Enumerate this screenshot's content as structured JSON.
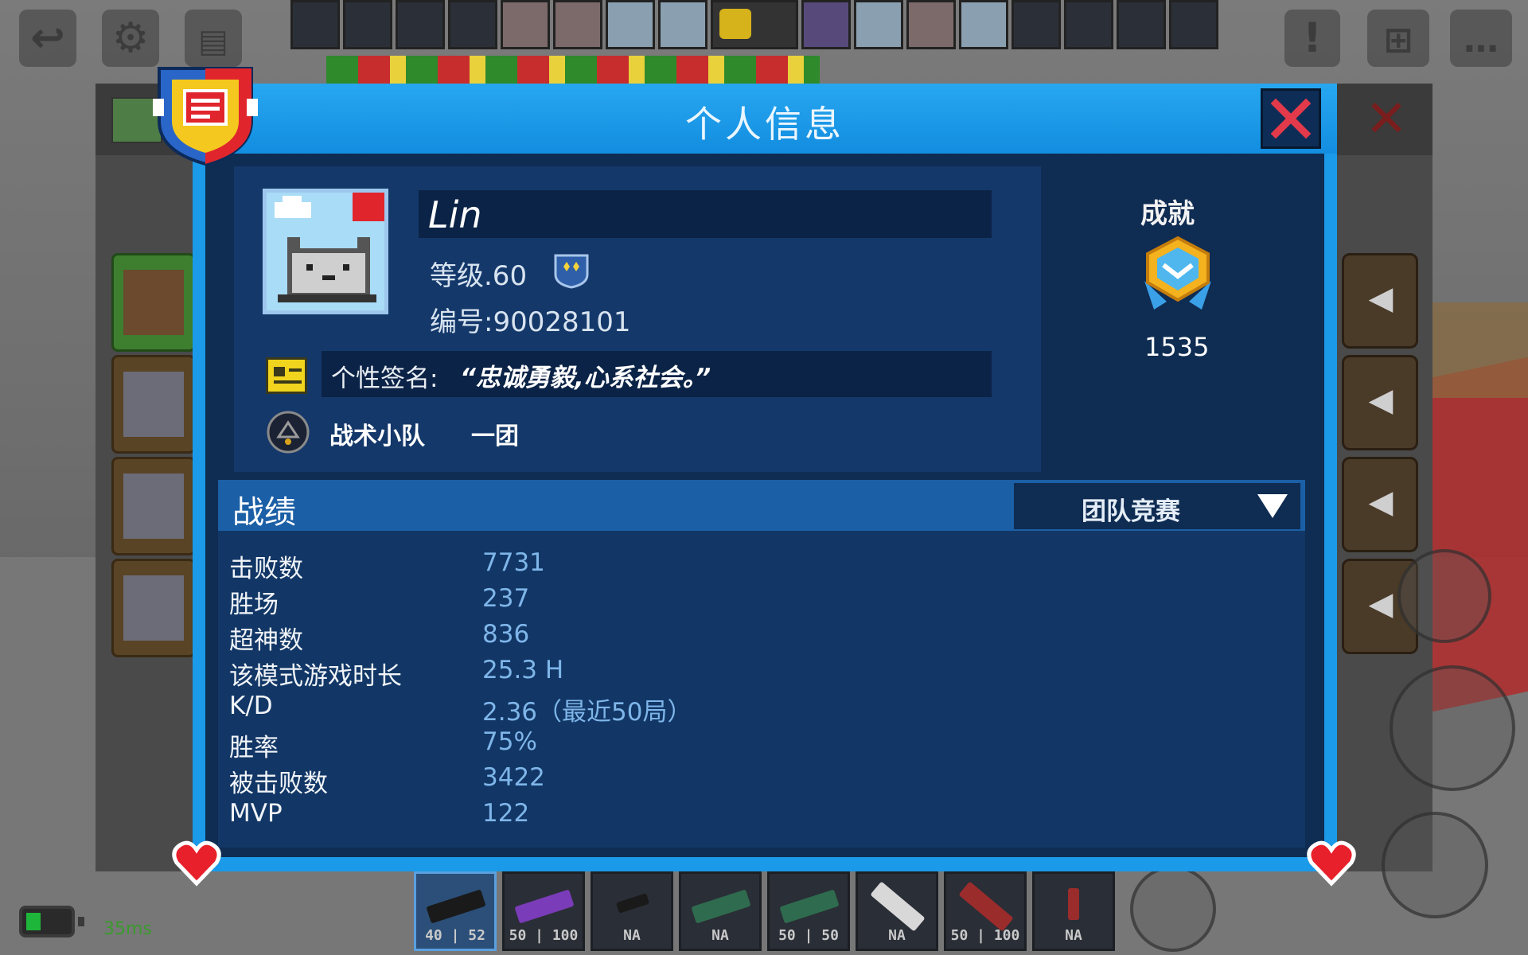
{
  "dialog": {
    "title": "个人信息"
  },
  "profile": {
    "name": "Lin",
    "level": "等级.60",
    "uid": "编号:90028101",
    "signature_label": "个性签名:",
    "signature": "“忠诚勇毅,心系社会。”",
    "squad_label": "战术小队",
    "squad_name": "一团"
  },
  "achievement": {
    "label": "成就",
    "value": "1535"
  },
  "stats": {
    "title": "战绩",
    "mode": "团队竞赛",
    "rows": [
      {
        "label": "击败数",
        "value": "7731"
      },
      {
        "label": "胜场",
        "value": "237"
      },
      {
        "label": "超神数",
        "value": "836"
      },
      {
        "label": "该模式游戏时长",
        "value": "25.3 H"
      },
      {
        "label": "K/D",
        "value": "2.36（最近50局）"
      },
      {
        "label": "胜率",
        "value": "75%"
      },
      {
        "label": "被击败数",
        "value": "3422"
      },
      {
        "label": "MVP",
        "value": "122"
      }
    ]
  },
  "hud": {
    "ping": "35ms",
    "weapons": [
      {
        "count": "40 | 52"
      },
      {
        "count": "50 | 100"
      },
      {
        "count": "NA"
      },
      {
        "count": "NA"
      },
      {
        "count": "50 | 50"
      },
      {
        "count": "NA"
      },
      {
        "count": "50 | 100"
      },
      {
        "count": "NA"
      }
    ]
  },
  "colors": {
    "frame": "#1a9ae8",
    "body": "#0f2c52",
    "stat_value": "#7fb6ea",
    "close": "#e23a4a"
  },
  "icons": [
    "back-icon",
    "gear-icon",
    "id-card-icon",
    "alert-icon",
    "add-friend-icon",
    "chat-icon",
    "close-icon",
    "rank-icon",
    "signature-icon",
    "squad-icon",
    "achievement-icon",
    "dropdown-arrow-icon",
    "heart-icon",
    "speaker-icon"
  ]
}
